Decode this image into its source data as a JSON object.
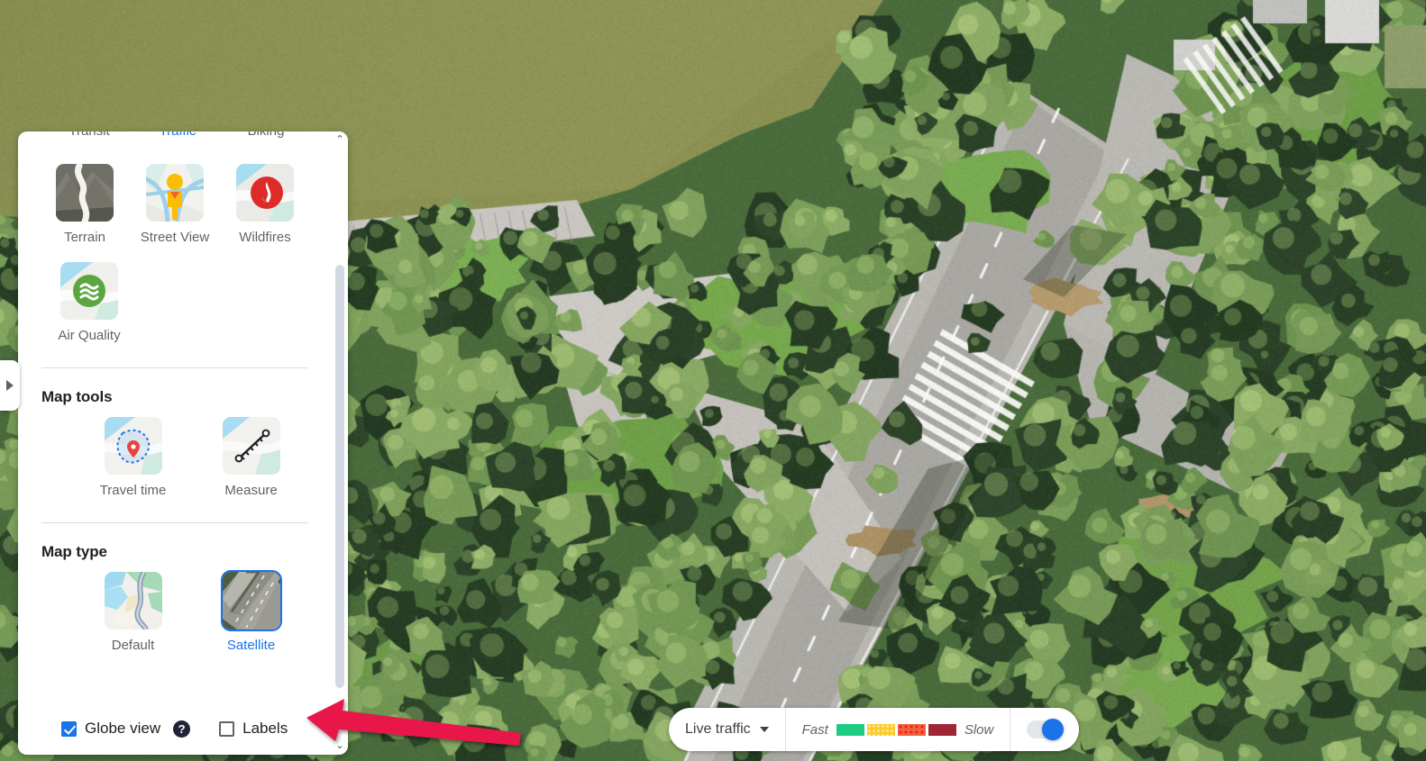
{
  "panel": {
    "clipped_top_row": [
      {
        "label": "Transit",
        "active": false
      },
      {
        "label": "Traffic",
        "active": true
      },
      {
        "label": "Biking",
        "active": false
      }
    ],
    "layers": [
      {
        "label": "Terrain",
        "icon": "terrain-icon",
        "selected": false
      },
      {
        "label": "Street View",
        "icon": "street-view-pegman-icon",
        "selected": false
      },
      {
        "label": "Wildfires",
        "icon": "wildfire-flame-icon",
        "selected": false
      },
      {
        "label": "Air Quality",
        "icon": "air-quality-waves-icon",
        "selected": false
      }
    ],
    "map_tools": {
      "title": "Map tools",
      "items": [
        {
          "label": "Travel time",
          "icon": "travel-time-pin-icon",
          "selected": false
        },
        {
          "label": "Measure",
          "icon": "measure-ruler-icon",
          "selected": false
        }
      ]
    },
    "map_type": {
      "title": "Map type",
      "items": [
        {
          "label": "Default",
          "icon": "default-map-icon",
          "selected": false
        },
        {
          "label": "Satellite",
          "icon": "satellite-map-icon",
          "selected": true
        }
      ]
    },
    "footer": {
      "globe_view": {
        "label": "Globe view",
        "checked": true
      },
      "help": {
        "glyph": "?",
        "name": "help-icon"
      },
      "labels": {
        "label": "Labels",
        "checked": false
      }
    },
    "scrollbar": {
      "up_glyph": "⌃",
      "down_glyph": "⌄"
    }
  },
  "collapse_handle": {
    "glyph": "▶",
    "name": "sidebar-expand-handle"
  },
  "traffic_legend": {
    "dropdown_label": "Live traffic",
    "fast_label": "Fast",
    "slow_label": "Slow",
    "swatch_colors": [
      "#1ecb83",
      "#fccc2e",
      "#f3603c",
      "#a02535"
    ],
    "toggle_on": true,
    "toggle_color": "#1a73e8"
  },
  "annotation": {
    "arrow_color": "#e8174a",
    "points_to": "labels-checkbox",
    "direction": "left"
  },
  "theme": {
    "accent": "#1a73e8",
    "text_primary": "#202124",
    "text_secondary": "#5f6368",
    "panel_bg": "#ffffff"
  }
}
